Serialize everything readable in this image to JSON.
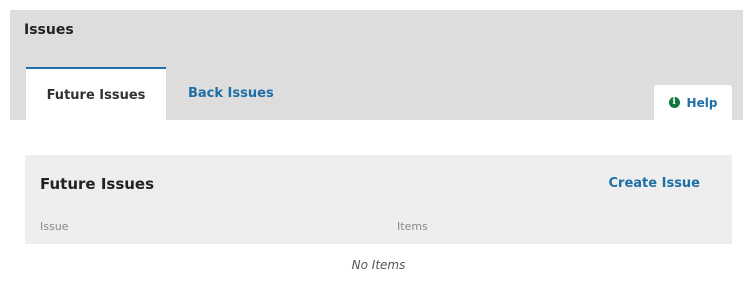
{
  "page": {
    "title": "Issues"
  },
  "tabs": [
    {
      "label": "Future Issues",
      "active": true
    },
    {
      "label": "Back Issues",
      "active": false
    }
  ],
  "help": {
    "icon": "info-icon",
    "icon_glyph": "i",
    "label": "Help"
  },
  "grid": {
    "title": "Future Issues",
    "action_label": "Create Issue",
    "columns": [
      "Issue",
      "Items"
    ],
    "empty_message": "No Items"
  },
  "colors": {
    "accent": "#1e6ea7",
    "help_icon": "#0b7a3b",
    "header_bg": "#dddddd",
    "panel_bg": "#eeeeee"
  }
}
